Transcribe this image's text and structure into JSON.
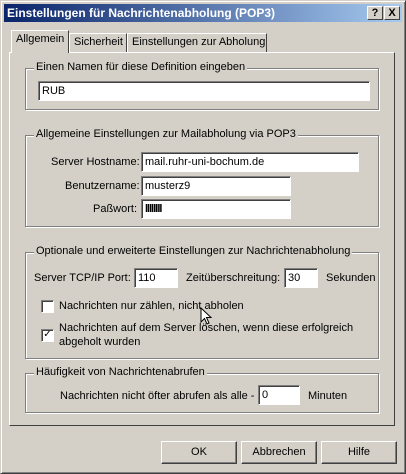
{
  "window": {
    "title": "Einstellungen für Nachrichtenabholung (POP3)",
    "help_button": "?",
    "close_button": "X"
  },
  "tabs": [
    {
      "label": "Allgemein",
      "active": true
    },
    {
      "label": "Sicherheit",
      "active": false
    },
    {
      "label": "Einstellungen zur Abholung",
      "active": false
    }
  ],
  "name_group": {
    "label": "Einen Namen für diese Definition eingeben",
    "value": "RUB"
  },
  "general_group": {
    "label": "Allgemeine Einstellungen zur Mailabholung via POP3",
    "host_label": "Server Hostname:",
    "host_value": "mail.ruhr-uni-bochum.de",
    "user_label": "Benutzername:",
    "user_value": "musterz9",
    "password_label": "Paßwort:",
    "password_value": "llllllll"
  },
  "optional_group": {
    "label": "Optionale und erweiterte Einstellungen zur Nachrichtenabholung",
    "port_label": "Server TCP/IP Port:",
    "port_value": "110",
    "timeout_label": "Zeitüberschreitung:",
    "timeout_value": "30",
    "timeout_unit": "Sekunden",
    "count_only_label": "Nachrichten nur zählen, nicht abholen",
    "count_only_checked": false,
    "delete_label_line1": "Nachrichten auf dem Server löschen, wenn diese erfolgreich",
    "delete_label_line2": "abgeholt wurden",
    "delete_checked": true
  },
  "frequency_group": {
    "label": "Häufigkeit von Nachrichtenabrufen",
    "interval_label": "Nachrichten nicht öfter abrufen als alle -",
    "interval_value": "0",
    "interval_unit": "Minuten"
  },
  "buttons": {
    "ok": "OK",
    "cancel": "Abbrechen",
    "help": "Hilfe"
  }
}
